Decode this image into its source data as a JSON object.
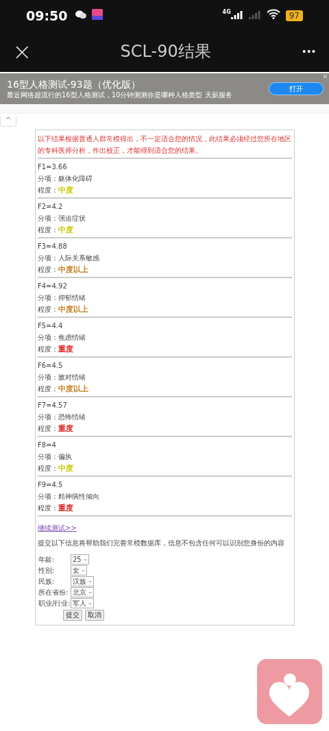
{
  "status_bar": {
    "time": "09:50",
    "network": "4G",
    "battery": "97"
  },
  "nav_bar": {
    "close": "×",
    "title": "SCL-90结果",
    "more": "•••"
  },
  "ad": {
    "title": "16型人格测试-93题（优化版）",
    "subtitle": "最近网络超流行的16型人格测试，10分钟测测你是哪种人格类型 天新服务",
    "button": "打开"
  },
  "notice": "以下结果根据普通人群常模得出，不一定适合您的情况，此结果必须经过您所在地区的专科医师分析，作出校正，才能得到适合您的结果。",
  "results": [
    {
      "score": "F1=3.66",
      "factor": "分项：躯体化障碍",
      "severity_label": "程度：",
      "severity": "中度",
      "color": "#c8c800"
    },
    {
      "score": "F2=4.2",
      "factor": "分项：强迫症状",
      "severity_label": "程度：",
      "severity": "中度",
      "color": "#c8c800"
    },
    {
      "score": "F3=4.88",
      "factor": "分项：人际关系敏感",
      "severity_label": "程度：",
      "severity": "中度以上",
      "color": "#c08020"
    },
    {
      "score": "F4=4.92",
      "factor": "分项：抑郁情绪",
      "severity_label": "程度：",
      "severity": "中度以上",
      "color": "#c08020"
    },
    {
      "score": "F5=4.4",
      "factor": "分项：焦虑情绪",
      "severity_label": "程度：",
      "severity": "重度",
      "color": "#e02020"
    },
    {
      "score": "F6=4.5",
      "factor": "分项：敌对情绪",
      "severity_label": "程度：",
      "severity": "中度以上",
      "color": "#c08020"
    },
    {
      "score": "F7=4.57",
      "factor": "分项：恐怖情绪",
      "severity_label": "程度：",
      "severity": "重度",
      "color": "#e02020"
    },
    {
      "score": "F8=4",
      "factor": "分项：偏执",
      "severity_label": "程度：",
      "severity": "中度",
      "color": "#c8c800"
    },
    {
      "score": "F9=4.5",
      "factor": "分项：精神病性倾向",
      "severity_label": "程度：",
      "severity": "重度",
      "color": "#e02020"
    }
  ],
  "continue_link": "继续测试>>",
  "form_intro": "提交以下信息将帮助我们完善常模数据库，信息不包含任何可以识别您身份的内容",
  "form_fields": [
    {
      "label": "年龄:",
      "value": "25"
    },
    {
      "label": "性别:",
      "value": "女"
    },
    {
      "label": "民族:",
      "value": "汉族"
    },
    {
      "label": "所在省份:",
      "value": "北京"
    },
    {
      "label": "职业/行业:",
      "value": "军人"
    }
  ],
  "form_buttons": [
    "提交",
    "取消"
  ]
}
